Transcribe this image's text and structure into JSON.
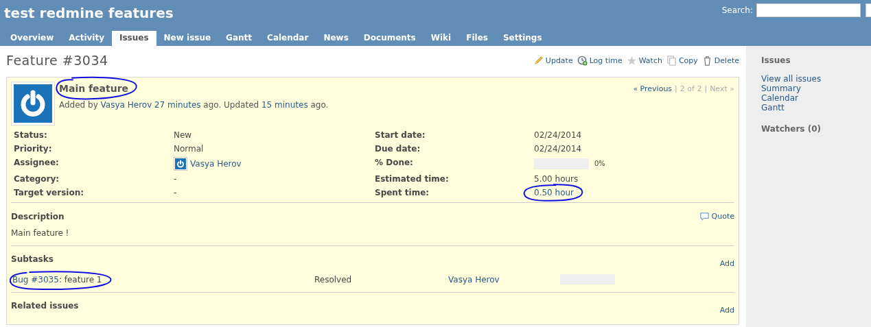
{
  "header": {
    "title": "test redmine features",
    "search_label": "Search:"
  },
  "tabs": [
    {
      "label": "Overview",
      "selected": false
    },
    {
      "label": "Activity",
      "selected": false
    },
    {
      "label": "Issues",
      "selected": true
    },
    {
      "label": "New issue",
      "selected": false
    },
    {
      "label": "Gantt",
      "selected": false
    },
    {
      "label": "Calendar",
      "selected": false
    },
    {
      "label": "News",
      "selected": false
    },
    {
      "label": "Documents",
      "selected": false
    },
    {
      "label": "Wiki",
      "selected": false
    },
    {
      "label": "Files",
      "selected": false
    },
    {
      "label": "Settings",
      "selected": false
    }
  ],
  "page_title": "Feature #3034",
  "actions": [
    {
      "label": "Update",
      "kind": "edit"
    },
    {
      "label": "Log time",
      "kind": "time"
    },
    {
      "label": "Watch",
      "kind": "watch"
    },
    {
      "label": "Copy",
      "kind": "copy"
    },
    {
      "label": "Delete",
      "kind": "delete"
    }
  ],
  "issue": {
    "subject": "Main feature",
    "pager": [
      {
        "kind": "link",
        "text": "« Previous",
        "disabled": false
      },
      {
        "kind": "separator",
        "text": "|"
      },
      {
        "kind": "count",
        "text": "2 of 2"
      },
      {
        "kind": "separator",
        "text": "|"
      },
      {
        "kind": "link",
        "text": "Next »",
        "disabled": true
      }
    ],
    "byline": [
      {
        "kind": "text",
        "text": "Added by "
      },
      {
        "kind": "link",
        "text": "Vasya Herov"
      },
      {
        "kind": "link",
        "text": "27 minutes"
      },
      {
        "kind": "text",
        "text": " ago. Updated "
      },
      {
        "kind": "link",
        "text": "15 minutes"
      },
      {
        "kind": "text",
        "text": " ago."
      }
    ],
    "attributes": [
      {
        "left": {
          "label": "Status:",
          "kind": "text",
          "value": "New"
        },
        "right": {
          "label": "Start date:",
          "kind": "text",
          "value": "02/24/2014"
        }
      },
      {
        "left": {
          "label": "Priority:",
          "kind": "text",
          "value": "Normal"
        },
        "right": {
          "label": "Due date:",
          "kind": "text",
          "value": "02/24/2014"
        }
      },
      {
        "left": {
          "label": "Assignee:",
          "kind": "user",
          "value": "Vasya Herov"
        },
        "right": {
          "label": "% Done:",
          "kind": "progress",
          "level": 0,
          "value": "0%"
        }
      },
      {
        "left": {
          "label": "Category:",
          "kind": "text",
          "value": "-"
        },
        "right": {
          "label": "Estimated time:",
          "kind": "text",
          "value": "5.00 hours"
        }
      },
      {
        "left": {
          "label": "Target version:",
          "kind": "text",
          "value": "-"
        },
        "right": {
          "label": "Spent time:",
          "kind": "link",
          "value": "0.50 hour"
        }
      }
    ],
    "description": {
      "heading": "Description",
      "quote": "Quote",
      "text": "Main feature !"
    },
    "subtasks": {
      "heading": "Subtasks",
      "add": "Add",
      "rows": [
        {
          "link": "Bug #3035",
          "title": ": feature 1",
          "status": "Resolved",
          "assignee": "Vasya Herov",
          "level": 0
        }
      ]
    },
    "related": {
      "heading": "Related issues",
      "add": "Add"
    }
  },
  "sidebar": {
    "heading": "Issues",
    "links": [
      "View all issues",
      "Summary",
      "Calendar",
      "Gantt"
    ],
    "watchers": "Watchers (0)"
  }
}
